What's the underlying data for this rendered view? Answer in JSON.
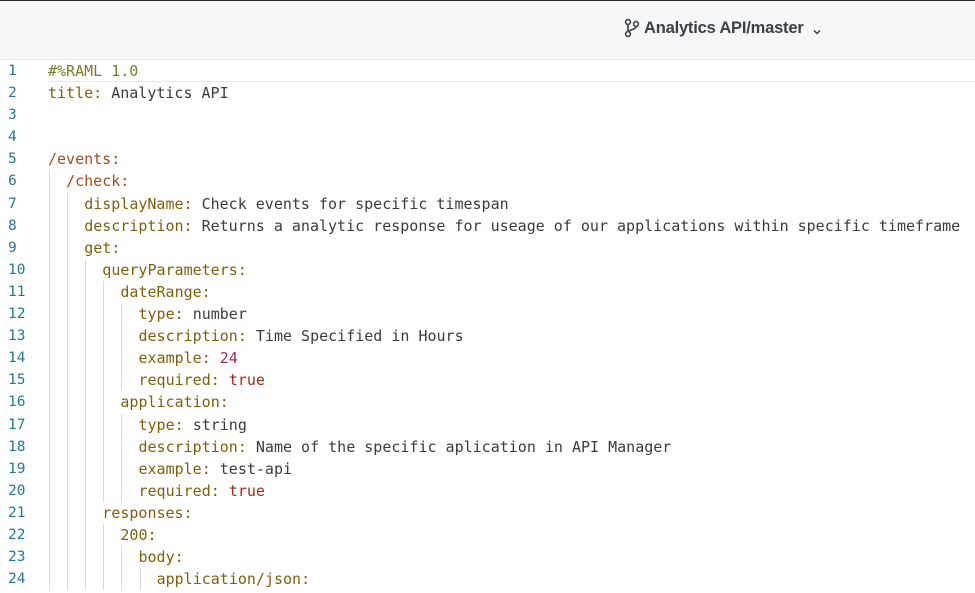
{
  "header": {
    "branch_label": "Analytics API/master",
    "branch_icon": "git-branch-icon",
    "dropdown_icon": "chevron-down-icon"
  },
  "editor": {
    "lines": [
      {
        "n": "1",
        "indent": 0,
        "key": "",
        "sep": "",
        "value": "#%RAML 1.0",
        "kc": "comment",
        "vc": "comment"
      },
      {
        "n": "2",
        "indent": 0,
        "key": "title",
        "sep": ": ",
        "value": "Analytics API",
        "kc": "key",
        "vc": "val"
      },
      {
        "n": "3",
        "indent": 0,
        "key": "",
        "sep": "",
        "value": "",
        "kc": "key",
        "vc": "val"
      },
      {
        "n": "4",
        "indent": 0,
        "key": "",
        "sep": "",
        "value": "",
        "kc": "key",
        "vc": "val"
      },
      {
        "n": "5",
        "indent": 0,
        "key": "/events",
        "sep": ":",
        "value": "",
        "kc": "path",
        "vc": "val"
      },
      {
        "n": "6",
        "indent": 1,
        "key": "/check",
        "sep": ":",
        "value": "",
        "kc": "path",
        "vc": "val"
      },
      {
        "n": "7",
        "indent": 2,
        "key": "displayName",
        "sep": ": ",
        "value": "Check events for specific timespan",
        "kc": "key",
        "vc": "val"
      },
      {
        "n": "8",
        "indent": 2,
        "key": "description",
        "sep": ": ",
        "value": "Returns a analytic response for useage of our applications within specific timeframe",
        "kc": "key",
        "vc": "val"
      },
      {
        "n": "9",
        "indent": 2,
        "key": "get",
        "sep": ":",
        "value": "",
        "kc": "key",
        "vc": "val"
      },
      {
        "n": "10",
        "indent": 3,
        "key": "queryParameters",
        "sep": ":",
        "value": "",
        "kc": "key",
        "vc": "val"
      },
      {
        "n": "11",
        "indent": 4,
        "key": "dateRange",
        "sep": ":",
        "value": "",
        "kc": "key",
        "vc": "val"
      },
      {
        "n": "12",
        "indent": 5,
        "key": "type",
        "sep": ": ",
        "value": "number",
        "kc": "key",
        "vc": "val"
      },
      {
        "n": "13",
        "indent": 5,
        "key": "description",
        "sep": ": ",
        "value": "Time Specified in Hours",
        "kc": "key",
        "vc": "val"
      },
      {
        "n": "14",
        "indent": 5,
        "key": "example",
        "sep": ": ",
        "value": "24",
        "kc": "key",
        "vc": "num"
      },
      {
        "n": "15",
        "indent": 5,
        "key": "required",
        "sep": ": ",
        "value": "true",
        "kc": "key",
        "vc": "bool"
      },
      {
        "n": "16",
        "indent": 4,
        "key": "application",
        "sep": ":",
        "value": "",
        "kc": "key",
        "vc": "val"
      },
      {
        "n": "17",
        "indent": 5,
        "key": "type",
        "sep": ": ",
        "value": "string",
        "kc": "key",
        "vc": "val"
      },
      {
        "n": "18",
        "indent": 5,
        "key": "description",
        "sep": ": ",
        "value": "Name of the specific aplication in API Manager",
        "kc": "key",
        "vc": "val"
      },
      {
        "n": "19",
        "indent": 5,
        "key": "example",
        "sep": ": ",
        "value": "test-api",
        "kc": "key",
        "vc": "val"
      },
      {
        "n": "20",
        "indent": 5,
        "key": "required",
        "sep": ": ",
        "value": "true",
        "kc": "key",
        "vc": "bool"
      },
      {
        "n": "21",
        "indent": 3,
        "key": "responses",
        "sep": ":",
        "value": "",
        "kc": "key",
        "vc": "val"
      },
      {
        "n": "22",
        "indent": 4,
        "key": "200",
        "sep": ":",
        "value": "",
        "kc": "key",
        "vc": "val"
      },
      {
        "n": "23",
        "indent": 5,
        "key": "body",
        "sep": ":",
        "value": "",
        "kc": "key",
        "vc": "val"
      },
      {
        "n": "24",
        "indent": 6,
        "key": "application/json",
        "sep": ":",
        "value": "",
        "kc": "key",
        "vc": "val"
      }
    ]
  }
}
